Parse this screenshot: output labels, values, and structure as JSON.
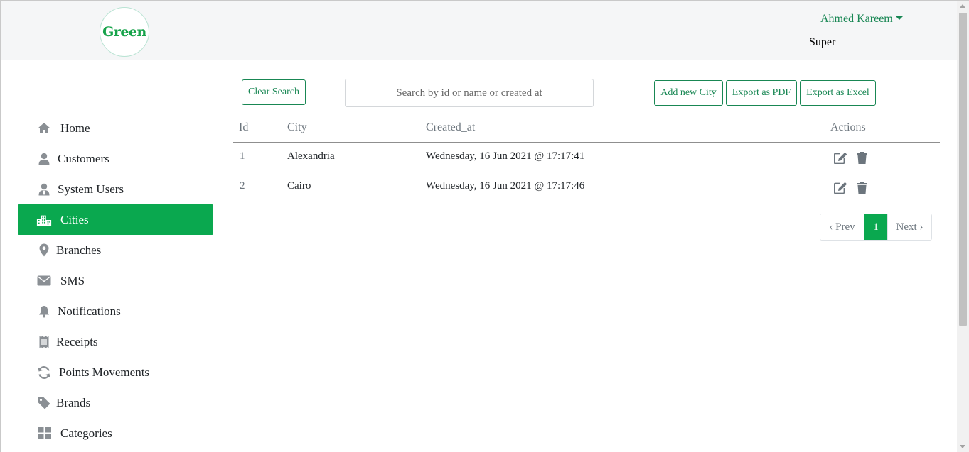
{
  "brand": {
    "logo_text": "Green"
  },
  "user": {
    "name": "Ahmed Kareem",
    "role": "Super"
  },
  "sidebar": {
    "items": [
      {
        "label": "Home",
        "icon": "home-icon"
      },
      {
        "label": "Customers",
        "icon": "user-icon"
      },
      {
        "label": "System Users",
        "icon": "user-tie-icon"
      },
      {
        "label": "Cities",
        "icon": "city-icon",
        "active": true
      },
      {
        "label": "Branches",
        "icon": "map-marker-icon"
      },
      {
        "label": "SMS",
        "icon": "envelope-icon"
      },
      {
        "label": "Notifications",
        "icon": "bell-icon"
      },
      {
        "label": "Receipts",
        "icon": "receipt-icon"
      },
      {
        "label": "Points Movements",
        "icon": "sync-icon"
      },
      {
        "label": "Brands",
        "icon": "tag-icon"
      },
      {
        "label": "Categories",
        "icon": "grid-icon"
      }
    ]
  },
  "toolbar": {
    "clear_search": "Clear Search",
    "search_placeholder": "Search by id or name or created at",
    "add_new": "Add new City",
    "export_pdf": "Export as PDF",
    "export_excel": "Export as Excel"
  },
  "table": {
    "headers": {
      "id": "Id",
      "city": "City",
      "created_at": "Created_at",
      "actions": "Actions"
    },
    "rows": [
      {
        "id": "1",
        "city": "Alexandria",
        "created_at": "Wednesday, 16 Jun 2021 @ 17:17:41"
      },
      {
        "id": "2",
        "city": "Cairo",
        "created_at": "Wednesday, 16 Jun 2021 @ 17:17:46"
      }
    ]
  },
  "pagination": {
    "prev": "‹ Prev",
    "current": "1",
    "next": "Next ›"
  },
  "colors": {
    "accent": "#0aa84f",
    "accent_text": "#198754",
    "header_bg": "#f5f6f7"
  }
}
